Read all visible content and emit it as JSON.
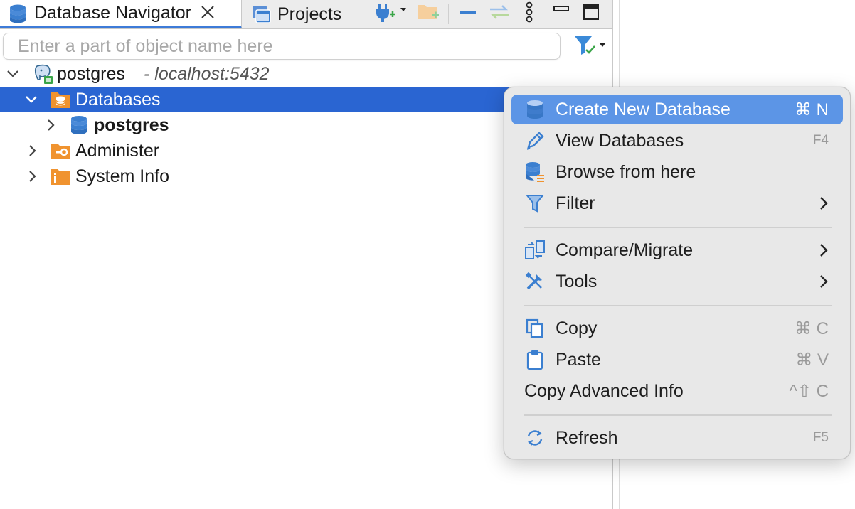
{
  "tabs": {
    "navigator_label": "Database Navigator",
    "projects_label": "Projects"
  },
  "search": {
    "placeholder": "Enter a part of object name here",
    "value": ""
  },
  "tree": {
    "connection_name": "postgres",
    "connection_host": "- localhost:5432",
    "databases_label": "Databases",
    "db_postgres_label": "postgres",
    "administer_label": "Administer",
    "system_info_label": "System Info"
  },
  "menu": {
    "create_new_database": "Create New Database",
    "create_new_database_shortcut": "⌘ N",
    "view_databases": "View Databases",
    "view_databases_shortcut": "F4",
    "browse_from_here": "Browse from here",
    "filter": "Filter",
    "compare_migrate": "Compare/Migrate",
    "tools": "Tools",
    "copy": "Copy",
    "copy_shortcut": "⌘ C",
    "paste": "Paste",
    "paste_shortcut": "⌘ V",
    "copy_advanced_info": "Copy Advanced Info",
    "copy_advanced_info_shortcut": "^⇧ C",
    "refresh": "Refresh",
    "refresh_shortcut": "F5"
  },
  "colors": {
    "selection": "#2a65d2",
    "menu_highlight": "#5c95e6",
    "db_icon_blue": "#3b7fd0",
    "folder_orange": "#f0932f",
    "tab_underline": "#3d7bd8"
  },
  "icons": {
    "navigator_tab": "database-stack-icon",
    "projects_tab": "projects-window-icon",
    "new_connection": "plug-plus-icon",
    "new_folder": "folder-plus-icon",
    "collapse": "collapse-all-icon",
    "link": "link-with-editor-icon",
    "more": "vertical-ellipsis-icon",
    "minimize": "minimize-icon",
    "maximize": "maximize-icon",
    "filter": "filter-check-icon"
  }
}
